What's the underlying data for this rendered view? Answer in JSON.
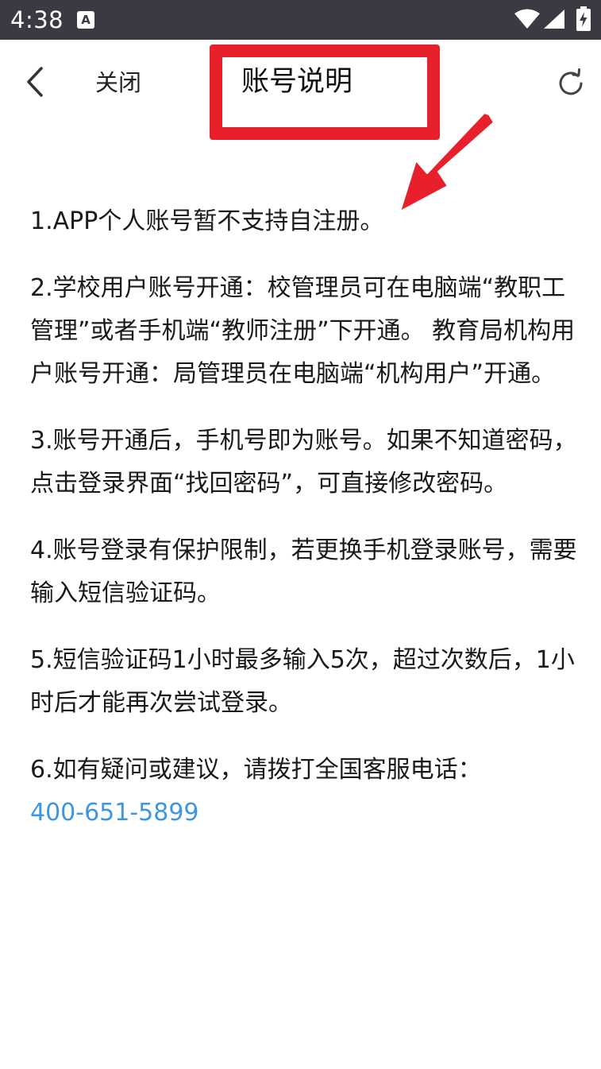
{
  "status_bar": {
    "time": "4:38",
    "notification_icon_letter": "A"
  },
  "header": {
    "close_label": "关闭",
    "title": "账号说明"
  },
  "content": {
    "paragraphs": [
      "1.APP个人账号暂不支持自注册。",
      "2.学校用户账号开通：校管理员可在电脑端“教职工管理”或者手机端“教师注册”下开通。 教育局机构用户账号开通：局管理员在电脑端“机构用户”开通。",
      "3.账号开通后，手机号即为账号。如果不知道密码，点击登录界面“找回密码”，可直接修改密码。",
      "4.账号登录有保护限制，若更换手机登录账号，需要输入短信验证码。",
      "5.短信验证码1小时最多输入5次，超过次数后，1小时后才能再次尝试登录。",
      "6.如有疑问或建议，请拨打全国客服电话："
    ],
    "phone": "400-651-5899"
  },
  "colors": {
    "status_bar_bg": "#3a3b42",
    "highlight_red": "#e8202b",
    "link_blue": "#3d97e0"
  },
  "icons": {
    "back": "chevron-left-icon",
    "refresh": "refresh-icon",
    "wifi": "wifi-icon",
    "signal": "signal-icon",
    "battery": "battery-charging-icon"
  }
}
